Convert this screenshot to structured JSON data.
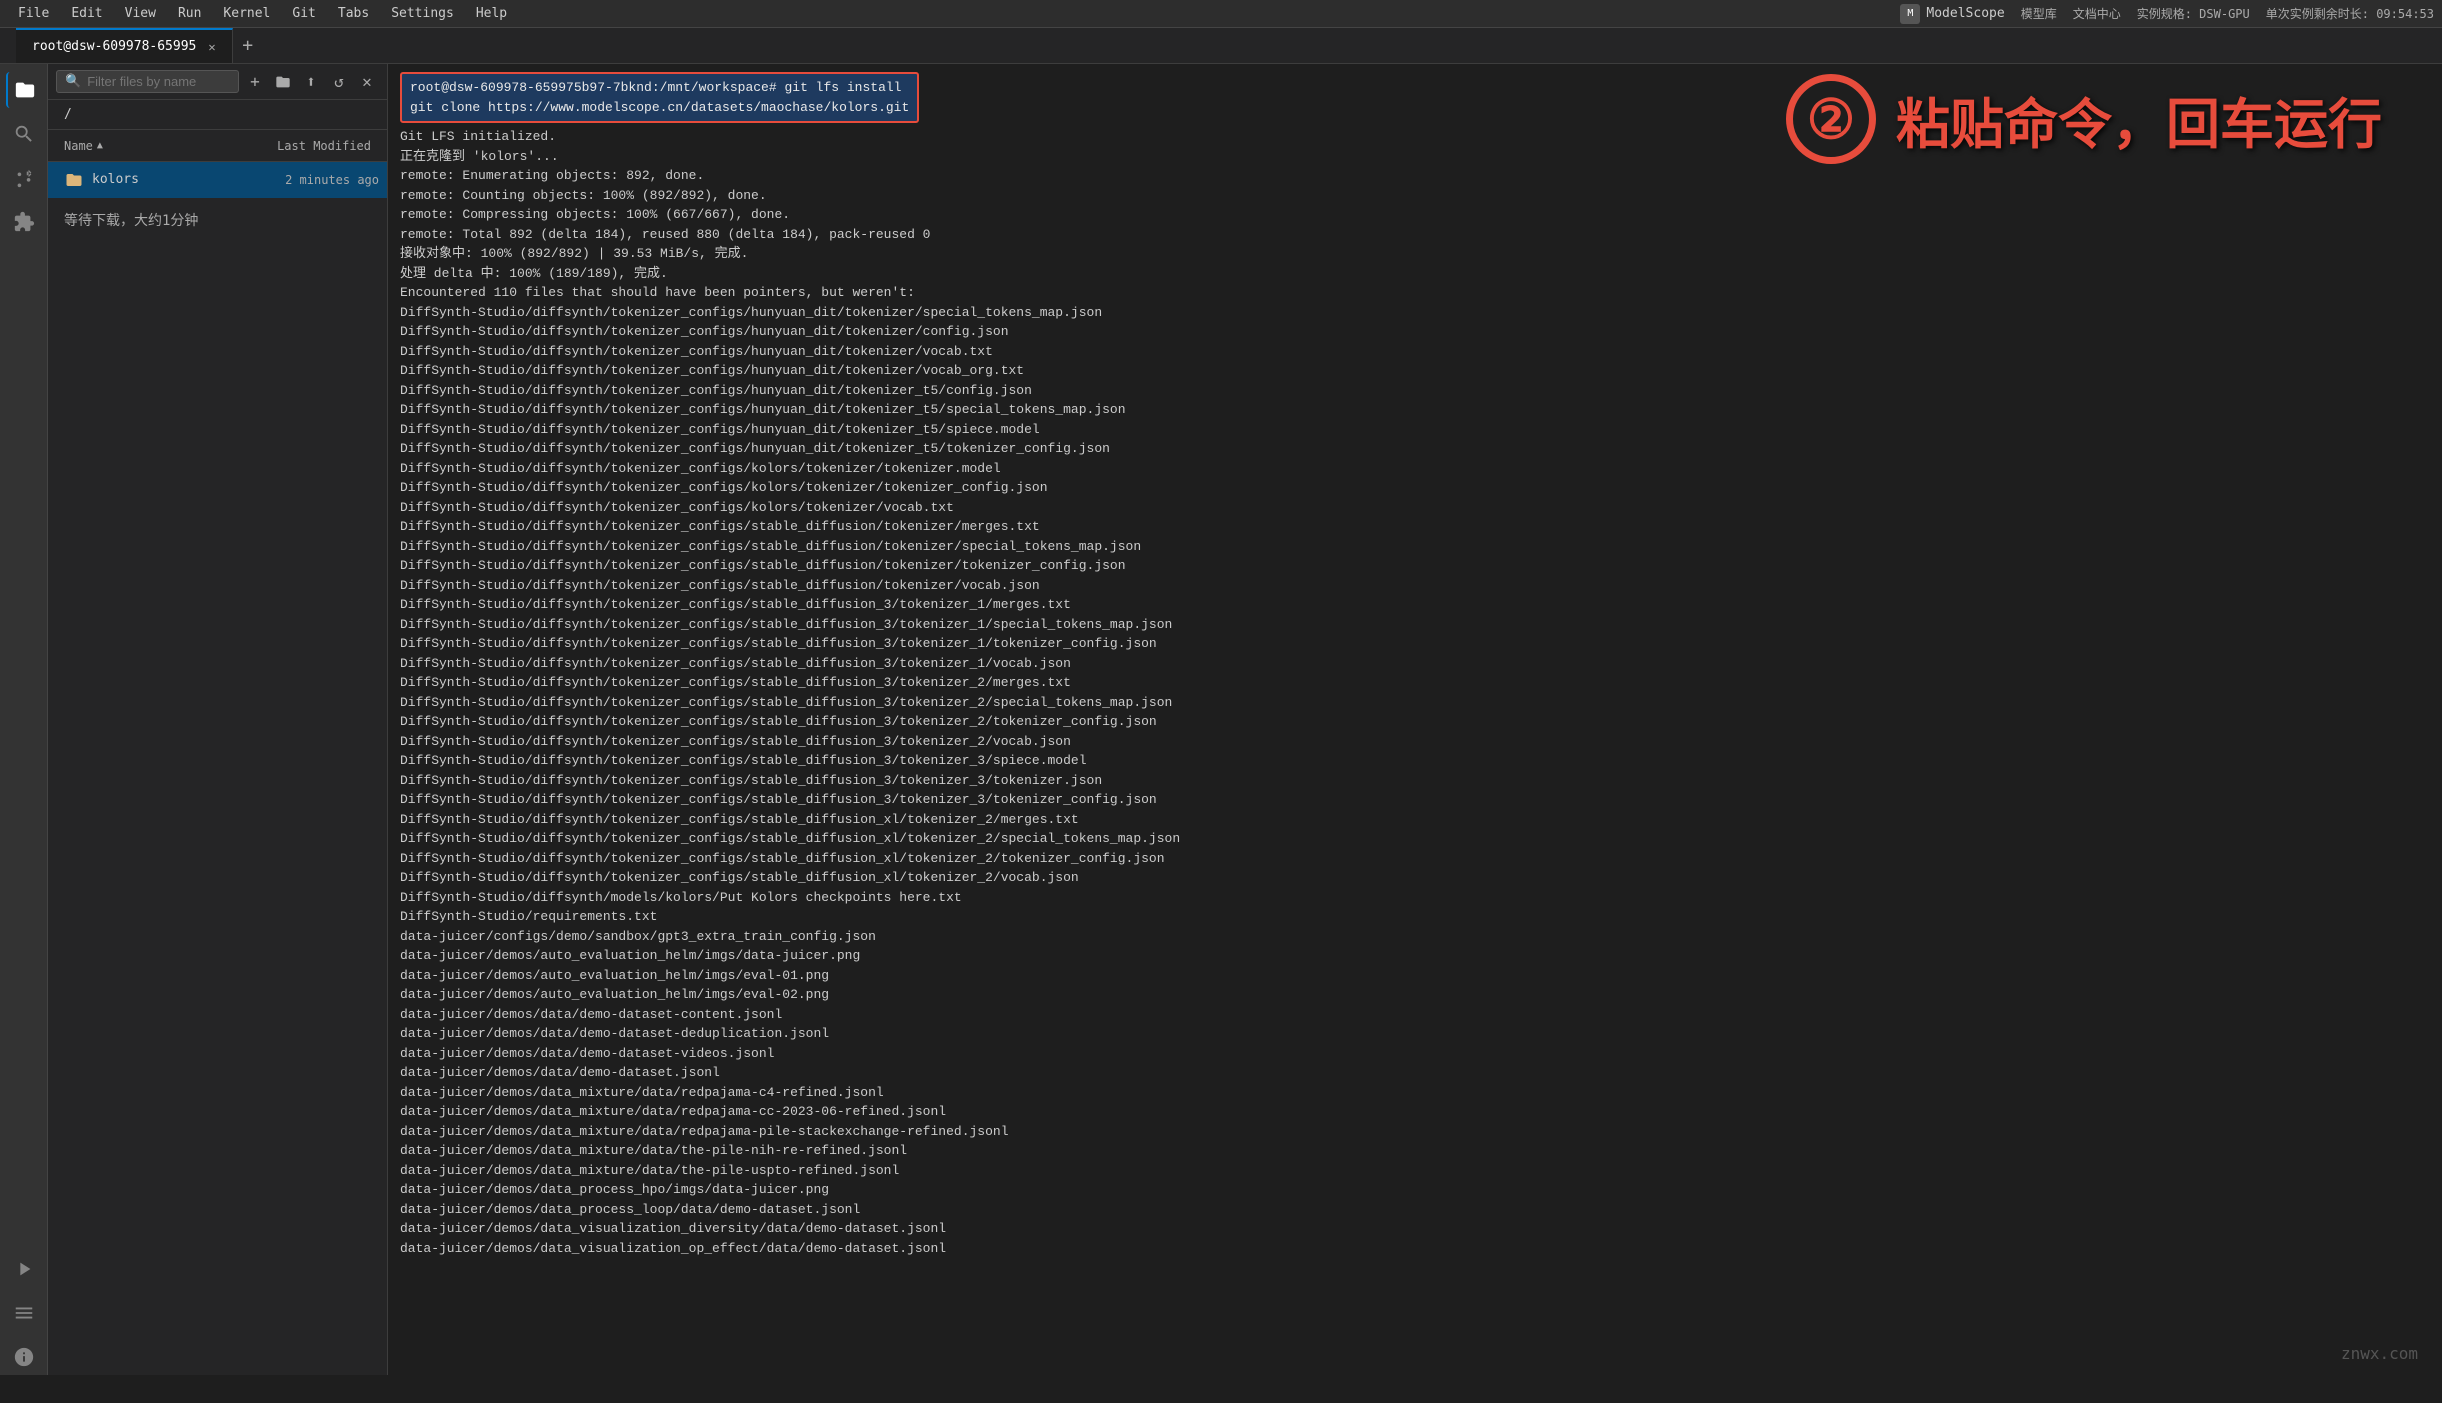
{
  "menubar": {
    "items": [
      "File",
      "Edit",
      "View",
      "Run",
      "Kernel",
      "Git",
      "Tabs",
      "Settings",
      "Help"
    ]
  },
  "topright": {
    "brand": "ModelScope",
    "links": [
      "模型库",
      "文档中心"
    ],
    "spec": "实例规格: DSW-GPU",
    "instance": "单次实例剩余时长: 09:54:53"
  },
  "tab": {
    "title": "root@dsw-609978-65995",
    "active": true
  },
  "sidebar": {
    "search_placeholder": "Filter files by name",
    "breadcrumb": "/",
    "col_name": "Name",
    "col_modified": "Last Modified",
    "files": [
      {
        "name": "kolors",
        "type": "folder",
        "modified": "2 minutes ago"
      }
    ],
    "wait_text": "等待下载，大约1分钟"
  },
  "terminal": {
    "command_line1": "root@dsw-609978-659975b97-7bknd:/mnt/workspace# git lfs install",
    "command_line2": "git clone https://www.modelscope.cn/datasets/maochase/kolors.git",
    "output_lines": [
      "Git LFS initialized.",
      "正在克隆到 'kolors'...",
      "remote: Enumerating objects: 892, done.",
      "remote: Counting objects: 100% (892/892), done.",
      "remote: Compressing objects: 100% (667/667), done.",
      "remote: Total 892 (delta 184), reused 880 (delta 184), pack-reused 0",
      "接收对象中: 100% (892/892) | 39.53 MiB/s, 完成.",
      "处理 delta 中: 100% (189/189), 完成.",
      "Encountered 110 files that should have been pointers, but weren't:",
      "        DiffSynth-Studio/diffsynth/tokenizer_configs/hunyuan_dit/tokenizer/special_tokens_map.json",
      "        DiffSynth-Studio/diffsynth/tokenizer_configs/hunyuan_dit/tokenizer/config.json",
      "        DiffSynth-Studio/diffsynth/tokenizer_configs/hunyuan_dit/tokenizer/vocab.txt",
      "        DiffSynth-Studio/diffsynth/tokenizer_configs/hunyuan_dit/tokenizer/vocab_org.txt",
      "        DiffSynth-Studio/diffsynth/tokenizer_configs/hunyuan_dit/tokenizer_t5/config.json",
      "        DiffSynth-Studio/diffsynth/tokenizer_configs/hunyuan_dit/tokenizer_t5/special_tokens_map.json",
      "        DiffSynth-Studio/diffsynth/tokenizer_configs/hunyuan_dit/tokenizer_t5/spiece.model",
      "        DiffSynth-Studio/diffsynth/tokenizer_configs/hunyuan_dit/tokenizer_t5/tokenizer_config.json",
      "        DiffSynth-Studio/diffsynth/tokenizer_configs/kolors/tokenizer/tokenizer.model",
      "        DiffSynth-Studio/diffsynth/tokenizer_configs/kolors/tokenizer/tokenizer_config.json",
      "        DiffSynth-Studio/diffsynth/tokenizer_configs/kolors/tokenizer/vocab.txt",
      "        DiffSynth-Studio/diffsynth/tokenizer_configs/stable_diffusion/tokenizer/merges.txt",
      "        DiffSynth-Studio/diffsynth/tokenizer_configs/stable_diffusion/tokenizer/special_tokens_map.json",
      "        DiffSynth-Studio/diffsynth/tokenizer_configs/stable_diffusion/tokenizer/tokenizer_config.json",
      "        DiffSynth-Studio/diffsynth/tokenizer_configs/stable_diffusion/tokenizer/vocab.json",
      "        DiffSynth-Studio/diffsynth/tokenizer_configs/stable_diffusion_3/tokenizer_1/merges.txt",
      "        DiffSynth-Studio/diffsynth/tokenizer_configs/stable_diffusion_3/tokenizer_1/special_tokens_map.json",
      "        DiffSynth-Studio/diffsynth/tokenizer_configs/stable_diffusion_3/tokenizer_1/tokenizer_config.json",
      "        DiffSynth-Studio/diffsynth/tokenizer_configs/stable_diffusion_3/tokenizer_1/vocab.json",
      "        DiffSynth-Studio/diffsynth/tokenizer_configs/stable_diffusion_3/tokenizer_2/merges.txt",
      "        DiffSynth-Studio/diffsynth/tokenizer_configs/stable_diffusion_3/tokenizer_2/special_tokens_map.json",
      "        DiffSynth-Studio/diffsynth/tokenizer_configs/stable_diffusion_3/tokenizer_2/tokenizer_config.json",
      "        DiffSynth-Studio/diffsynth/tokenizer_configs/stable_diffusion_3/tokenizer_2/vocab.json",
      "        DiffSynth-Studio/diffsynth/tokenizer_configs/stable_diffusion_3/tokenizer_3/spiece.model",
      "        DiffSynth-Studio/diffsynth/tokenizer_configs/stable_diffusion_3/tokenizer_3/tokenizer.json",
      "        DiffSynth-Studio/diffsynth/tokenizer_configs/stable_diffusion_3/tokenizer_3/tokenizer_config.json",
      "        DiffSynth-Studio/diffsynth/tokenizer_configs/stable_diffusion_xl/tokenizer_2/merges.txt",
      "        DiffSynth-Studio/diffsynth/tokenizer_configs/stable_diffusion_xl/tokenizer_2/special_tokens_map.json",
      "        DiffSynth-Studio/diffsynth/tokenizer_configs/stable_diffusion_xl/tokenizer_2/tokenizer_config.json",
      "        DiffSynth-Studio/diffsynth/tokenizer_configs/stable_diffusion_xl/tokenizer_2/vocab.json",
      "        DiffSynth-Studio/diffsynth/models/kolors/Put Kolors checkpoints here.txt",
      "        DiffSynth-Studio/requirements.txt",
      "        data-juicer/configs/demo/sandbox/gpt3_extra_train_config.json",
      "        data-juicer/demos/auto_evaluation_helm/imgs/data-juicer.png",
      "        data-juicer/demos/auto_evaluation_helm/imgs/eval-01.png",
      "        data-juicer/demos/auto_evaluation_helm/imgs/eval-02.png",
      "        data-juicer/demos/data/demo-dataset-content.jsonl",
      "        data-juicer/demos/data/demo-dataset-deduplication.jsonl",
      "        data-juicer/demos/data/demo-dataset-videos.jsonl",
      "        data-juicer/demos/data/demo-dataset.jsonl",
      "        data-juicer/demos/data_mixture/data/redpajama-c4-refined.jsonl",
      "        data-juicer/demos/data_mixture/data/redpajama-cc-2023-06-refined.jsonl",
      "        data-juicer/demos/data_mixture/data/redpajama-pile-stackexchange-refined.jsonl",
      "        data-juicer/demos/data_mixture/data/the-pile-nih-re-refined.jsonl",
      "        data-juicer/demos/data_mixture/data/the-pile-uspto-refined.jsonl",
      "        data-juicer/demos/data_process_hpo/imgs/data-juicer.png",
      "        data-juicer/demos/data_process_loop/data/demo-dataset.jsonl",
      "        data-juicer/demos/data_visualization_diversity/data/demo-dataset.jsonl",
      "        data-juicer/demos/data_visualization_op_effect/data/demo-dataset.jsonl"
    ]
  },
  "annotation": {
    "circle_number": "②",
    "chinese_text": "粘贴命令，回车运行"
  },
  "bottom_watermark": "znwx.com",
  "icons": {
    "new_file": "+",
    "new_folder": "📁",
    "upload": "⬆",
    "refresh": "↺",
    "clear": "✕",
    "search": "🔍",
    "explorer": "📄",
    "source_control": "⎇",
    "extensions": "⊞",
    "run": "▶",
    "git": "⎇"
  }
}
